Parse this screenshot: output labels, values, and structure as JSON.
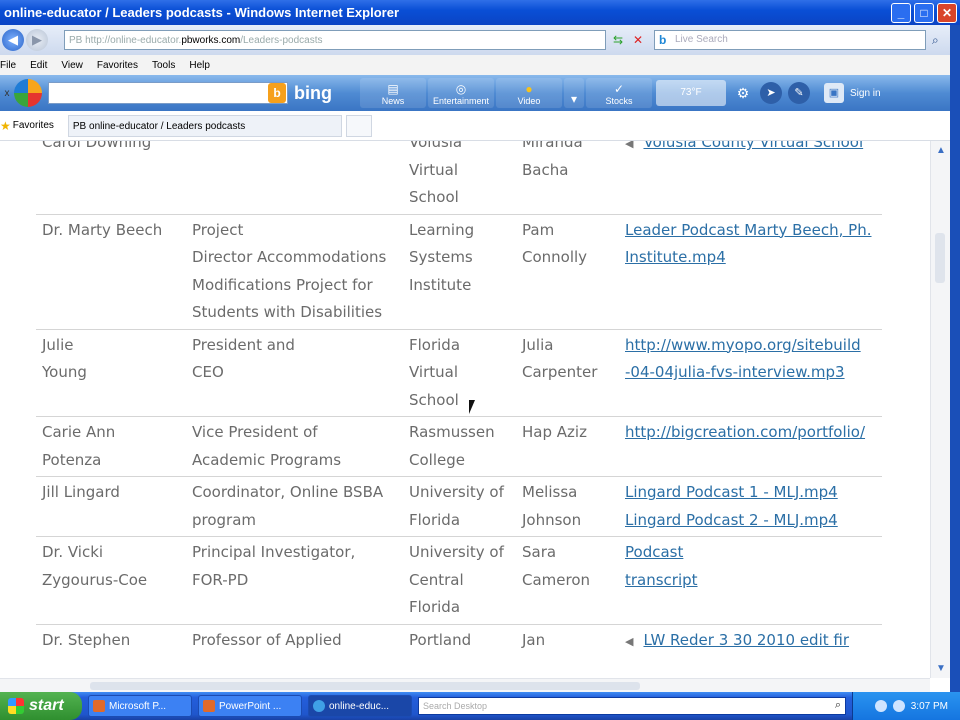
{
  "window": {
    "title": "online-educator / Leaders podcasts - Windows Internet Explorer",
    "minimize": "_",
    "maximize": "□",
    "close": "✕"
  },
  "nav": {
    "back": "◀",
    "forward": "▶",
    "address_prefix": "PB",
    "address_blur_start": "http://online-educator.",
    "address_host": "pbworks.com",
    "address_blur_end": "/Leaders-podcasts",
    "search_placeholder": "Live Search",
    "search_logo": "b",
    "search_go": "⌕"
  },
  "menu": [
    "File",
    "Edit",
    "View",
    "Favorites",
    "Tools",
    "Help"
  ],
  "msn_toolbar": {
    "close": "x",
    "bing_icon": "b",
    "bing_label": "bing",
    "buttons": [
      {
        "icon": "▤",
        "label": "News"
      },
      {
        "icon": "◎",
        "label": "Entertainment"
      },
      {
        "icon": "●",
        "label": "Video"
      },
      {
        "icon": "▾",
        "label": ""
      },
      {
        "icon": "✓",
        "label": "Stocks"
      }
    ],
    "weather": "73°F",
    "settings": "⚙",
    "sign_in": "Sign in"
  },
  "favorites": {
    "label": "Favorites",
    "tab_title": "PB online-educator / Leaders podcasts"
  },
  "table": {
    "rows": [
      {
        "name": [
          "Carol Downing"
        ],
        "title": [
          ""
        ],
        "org": [
          "Volusia",
          "Virtual",
          "School"
        ],
        "interviewer": [
          "Miranda",
          "Bacha"
        ],
        "speaker": true,
        "links": [
          "Volusia County Virtual School"
        ]
      },
      {
        "name": [
          "Dr. Marty Beech"
        ],
        "title": [
          "Project",
          "Director Accommodations",
          "Modifications Project for",
          "Students with Disabilities"
        ],
        "org": [
          "Learning",
          "Systems",
          "Institute"
        ],
        "interviewer": [
          "Pam",
          "Connolly"
        ],
        "speaker": false,
        "links": [
          "Leader Podcast Marty Beech, Ph.",
          "Institute.mp4"
        ]
      },
      {
        "name": [
          "Julie",
          "Young"
        ],
        "title": [
          "President and",
          "CEO"
        ],
        "org": [
          "Florida",
          "Virtual",
          "School"
        ],
        "interviewer": [
          "Julia",
          "Carpenter"
        ],
        "speaker": false,
        "links": [
          " http://www.myopo.org/sitebuild",
          "-04-04julia-fvs-interview.mp3"
        ]
      },
      {
        "name": [
          " Carie Ann",
          "Potenza"
        ],
        "title": [
          "Vice President of",
          "Academic Programs"
        ],
        "org": [
          "Rasmussen",
          "College"
        ],
        "interviewer": [
          "Hap Aziz"
        ],
        "speaker": false,
        "links": [
          "http://bigcreation.com/portfolio/"
        ]
      },
      {
        "name": [
          "Jill Lingard"
        ],
        "title": [
          "Coordinator, Online BSBA",
          "program"
        ],
        "org": [
          "University of",
          "Florida"
        ],
        "interviewer": [
          "Melissa",
          "Johnson"
        ],
        "speaker": false,
        "links": [
          "Lingard Podcast 1 - MLJ.mp4",
          "Lingard Podcast 2 - MLJ.mp4"
        ]
      },
      {
        "name": [
          "Dr. Vicki",
          "Zygourus-Coe"
        ],
        "title": [
          "Principal Investigator,",
          "FOR-PD"
        ],
        "org": [
          "University of",
          "Central",
          "Florida"
        ],
        "interviewer": [
          "Sara",
          "Cameron"
        ],
        "speaker": false,
        "links": [
          "Podcast",
          "transcript"
        ]
      },
      {
        "name": [
          "Dr. Stephen"
        ],
        "title": [
          "Professor of Applied"
        ],
        "org": [
          "Portland"
        ],
        "interviewer": [
          "Jan"
        ],
        "speaker": true,
        "links": [
          "LW Reder 3 30 2010 edit fir"
        ]
      }
    ]
  },
  "taskbar": {
    "start": "start",
    "tasks": [
      "Microsoft P...",
      "PowerPoint ...",
      "online-educ..."
    ],
    "search_placeholder": "Search Desktop",
    "clock": "3:07 PM"
  },
  "colors": {
    "link": "#2b6fa6",
    "body_text": "#6b6b6b",
    "titlebar": "#0a4fd6"
  }
}
